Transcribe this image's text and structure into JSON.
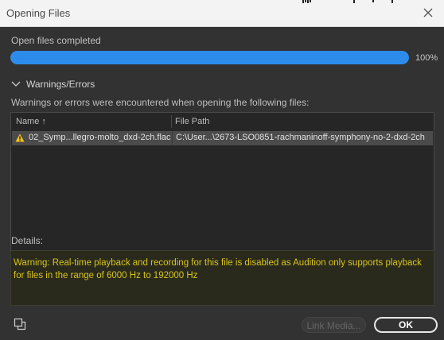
{
  "window": {
    "title": "Opening Files"
  },
  "progress": {
    "status": "Open files completed",
    "percent_label": "100%",
    "value": 1.0
  },
  "warnings": {
    "section_title": "Warnings/Errors",
    "description": "Warnings or errors were encountered when opening the following files:",
    "columns": [
      "Name",
      "File Path"
    ],
    "sort_indicator": "↑",
    "rows": [
      {
        "name": "02_Symp...llegro-molto_dxd-2ch.flac",
        "path": "C:\\User...\\2673-LSO0851-rachmaninoff-symphony-no-2-dxd-2ch",
        "icon": "warning-icon"
      }
    ]
  },
  "details": {
    "label": "Details:",
    "text": "Warning: Real-time playback and recording for this file is disabled as Audition only supports playback for files in the range of 6000 Hz to 192000 Hz"
  },
  "buttons": {
    "link_media": "Link Media...",
    "ok": "OK"
  },
  "colors": {
    "accent": "#2d8ceb",
    "warning_text": "#d7c41e",
    "warning_icon": "#f0c419"
  }
}
